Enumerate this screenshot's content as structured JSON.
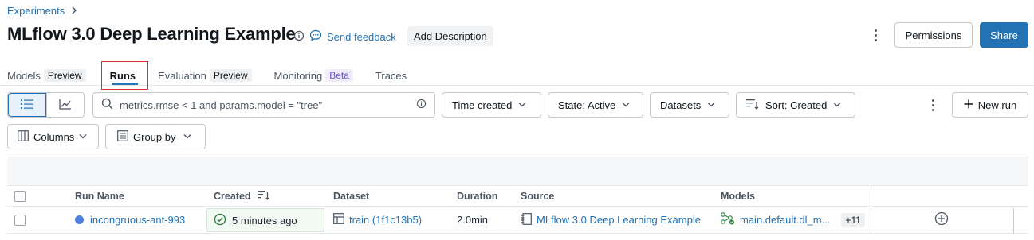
{
  "breadcrumb": {
    "parent": "Experiments"
  },
  "title": "MLflow 3.0 Deep Learning Example",
  "header": {
    "feedback_label": "Send feedback",
    "add_description_label": "Add Description",
    "permissions_label": "Permissions",
    "share_label": "Share"
  },
  "tabs": [
    {
      "label": "Models",
      "badge": "Preview"
    },
    {
      "label": "Runs",
      "active": true
    },
    {
      "label": "Evaluation",
      "badge": "Preview"
    },
    {
      "label": "Monitoring",
      "badge": "Beta"
    },
    {
      "label": "Traces"
    }
  ],
  "toolbar": {
    "search_placeholder": "metrics.rmse < 1 and params.model = \"tree\"",
    "time_created_label": "Time created",
    "state_label": "State: Active",
    "datasets_label": "Datasets",
    "sort_label": "Sort: Created",
    "new_run_label": "New run",
    "columns_label": "Columns",
    "group_by_label": "Group by"
  },
  "table": {
    "columns": [
      "Run Name",
      "Created",
      "Dataset",
      "Duration",
      "Source",
      "Models"
    ],
    "rows": [
      {
        "run_name": "incongruous-ant-993",
        "created": "5 minutes ago",
        "dataset": "train (1f1c13b5)",
        "duration": "2.0min",
        "source": "MLflow 3.0 Deep Learning Example",
        "models": "main.default.dl_m...",
        "models_more": "+11"
      }
    ]
  },
  "colors": {
    "primary": "#2272b4",
    "highlight_box": "#d92e2e",
    "success": "#2e8540",
    "run_dot": "#4f7fde"
  }
}
